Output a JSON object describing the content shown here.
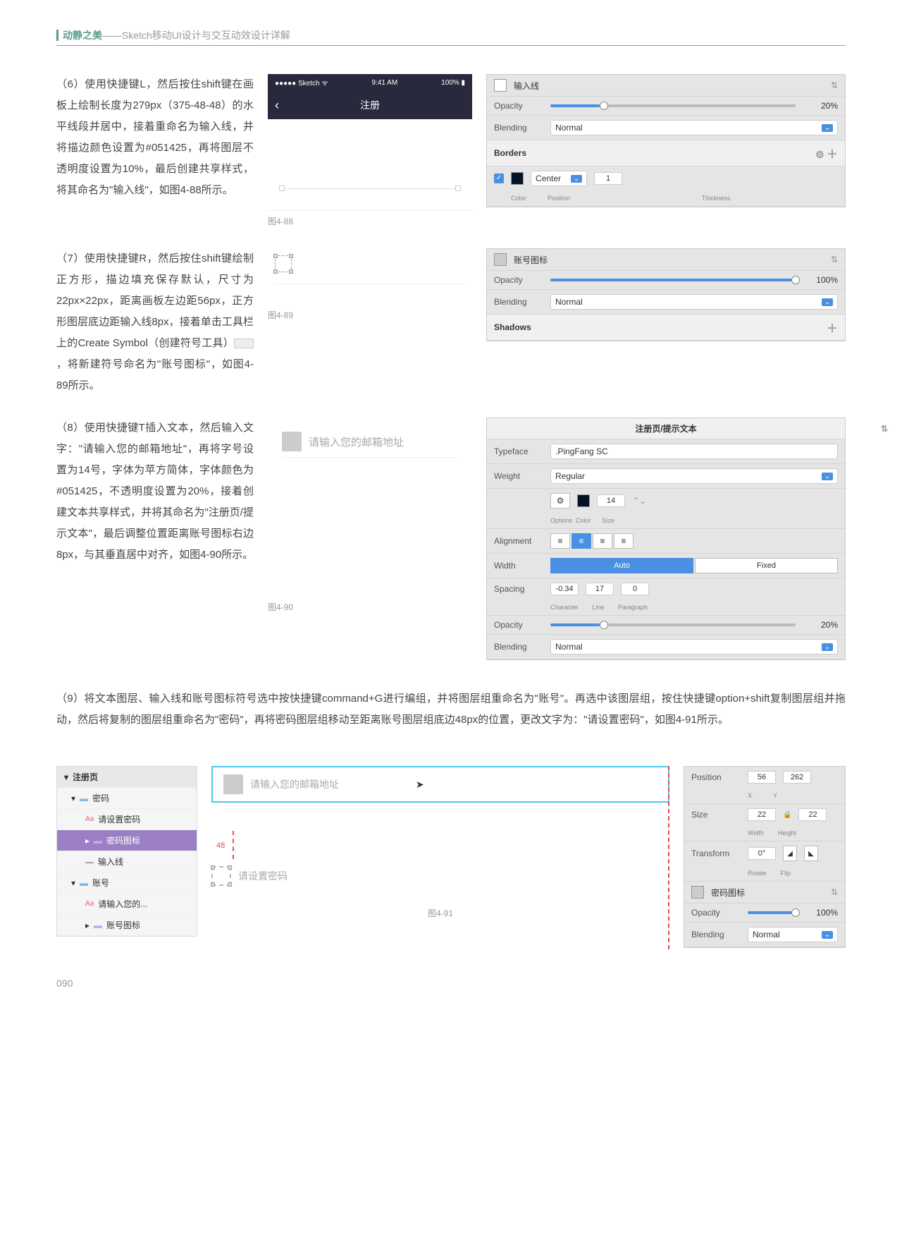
{
  "header": {
    "brand": "动静之美",
    "subtitle": "——Sketch移动UI设计与交互动效设计详解"
  },
  "para6": "（6）使用快捷键L，然后按住shift键在画板上绘制长度为279px（375-48-48）的水平线段并居中，接着重命名为输入线，并将描边颜色设置为#051425，再将图层不透明度设置为10%，最后创建共享样式，将其命名为\"输入线\"，如图4-88所示。",
  "para7_a": "（7）使用快捷键R，然后按住shift键绘制正方形，描边填充保存默认，尺寸为22px×22px，距离画板左边距56px，正方形图层底边距输入线8px，接着单击工具栏上的Create Symbol（创建符号工具）",
  "para7_b": "，将新建符号命名为\"账号图标\"，如图4-89所示。",
  "para8": "（8）使用快捷键T插入文本，然后输入文字：\"请输入您的邮箱地址\"，再将字号设置为14号，字体为苹方简体，字体颜色为#051425，不透明度设置为20%，接着创建文本共享样式，并将其命名为\"注册页/提示文本\"，最后调整位置距离账号图标右边8px，与其垂直居中对齐，如图4-90所示。",
  "para9": "（9）将文本图层、输入线和账号图标符号选中按快捷键command+G进行编组，并将图层组重命名为\"账号\"。再选中该图层组，按住快捷键option+shift复制图层组并拖动，然后将复制的图层组重命名为\"密码\"，再将密码图层组移动至距离账号图层组底边48px的位置，更改文字为：\"请设置密码\"，如图4-91所示。",
  "phone": {
    "carrier": "●●●●● Sketch ᯤ",
    "time": "9:41 AM",
    "battery": "100% ▮",
    "title": "注册"
  },
  "cap": {
    "c88": "图4-88",
    "c89": "图4-89",
    "c90": "图4-90",
    "c91": "图4-91"
  },
  "p88": {
    "name": "输入线",
    "opacity_label": "Opacity",
    "opacity_val": "20%",
    "blend_label": "Blending",
    "blend_val": "Normal",
    "borders": "Borders",
    "center": "Center",
    "thick": "1",
    "color": "Color",
    "position": "Position",
    "thickness": "Thickness"
  },
  "p89": {
    "name": "账号图标",
    "opacity_val": "100%",
    "shadows": "Shadows"
  },
  "p90": {
    "title": "注册页/提示文本",
    "typeface": "Typeface",
    "typeface_val": ".PingFang SC",
    "weight": "Weight",
    "weight_val": "Regular",
    "options": "Options",
    "color": "Color",
    "size": "Size",
    "size_val": "14",
    "align": "Alignment",
    "width": "Width",
    "auto": "Auto",
    "fixed": "Fixed",
    "spacing": "Spacing",
    "char": "-0.34",
    "line": "17",
    "parag": "0",
    "char_l": "Character",
    "line_l": "Line",
    "parag_l": "Paragraph",
    "opacity": "Opacity",
    "opacity_val": "20%",
    "blend": "Blending",
    "blend_val": "Normal"
  },
  "mock3": {
    "placeholder": "请输入您的邮箱地址"
  },
  "layers": {
    "root": "注册页",
    "pwd": "密码",
    "pwd_txt": "请设置密码",
    "pwd_icon": "密码图标",
    "input_line": "输入线",
    "acc": "账号",
    "acc_txt": "请输入您的...",
    "acc_icon": "账号图标"
  },
  "canvas": {
    "email": "请输入您的邮箱地址",
    "dist": "48",
    "pwd": "请设置密码"
  },
  "props": {
    "position": "Position",
    "size": "Size",
    "transform": "Transform",
    "x": "56",
    "y": "262",
    "w": "22",
    "h": "22",
    "x_l": "X",
    "y_l": "Y",
    "w_l": "Width",
    "h_l": "Height",
    "rot": "0°",
    "rot_l": "Rotate",
    "flip_l": "Flip",
    "name": "密码图标",
    "opacity": "Opacity",
    "opacity_val": "100%",
    "blend": "Blending",
    "blend_val": "Normal"
  },
  "pagenum": "090"
}
